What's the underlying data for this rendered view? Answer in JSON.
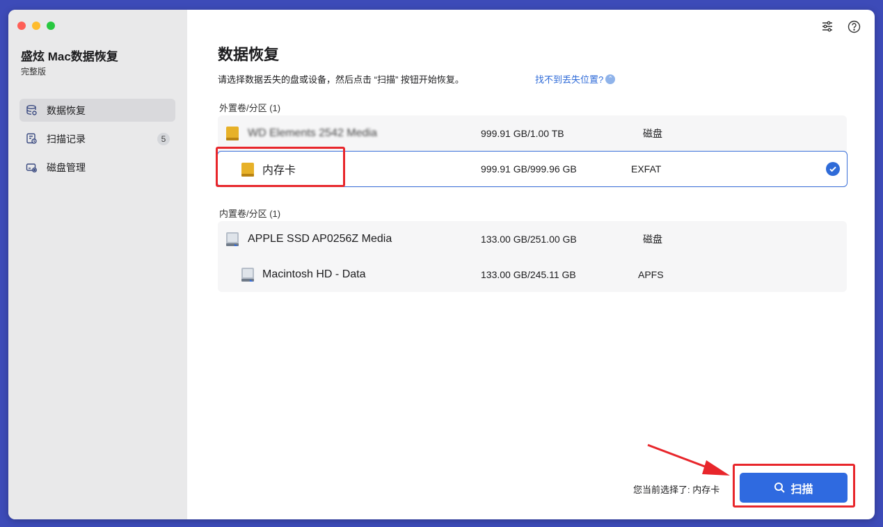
{
  "app": {
    "title": "盛炫 Mac数据恢复",
    "edition": "完整版"
  },
  "sidebar": {
    "items": [
      {
        "label": "数据恢复",
        "icon": "database-icon"
      },
      {
        "label": "扫描记录",
        "icon": "scan-history-icon",
        "badge": "5"
      },
      {
        "label": "磁盘管理",
        "icon": "disk-settings-icon"
      }
    ]
  },
  "main": {
    "title": "数据恢复",
    "instruction": "请选择数据丢失的盘或设备，然后点击 “扫描” 按钮开始恢复。",
    "help_link": "找不到丢失位置?",
    "external_section": "外置卷/分区 (1)",
    "external_rows": [
      {
        "name": "WD Elements 2542 Media",
        "size": "999.91 GB/1.00 TB",
        "fs": "磁盘"
      },
      {
        "name": "内存卡",
        "size": "999.91 GB/999.96 GB",
        "fs": "EXFAT"
      }
    ],
    "internal_section": "内置卷/分区 (1)",
    "internal_rows": [
      {
        "name": "APPLE SSD AP0256Z Media",
        "size": "133.00 GB/251.00 GB",
        "fs": "磁盘"
      },
      {
        "name": "Macintosh HD - Data",
        "size": "133.00 GB/245.11 GB",
        "fs": "APFS"
      }
    ]
  },
  "footer": {
    "current_selection": "您当前选择了: 内存卡",
    "scan_label": "扫描"
  },
  "colors": {
    "accent": "#2f6ae0",
    "highlight": "#e8262b",
    "background": "#3d4bb8"
  }
}
